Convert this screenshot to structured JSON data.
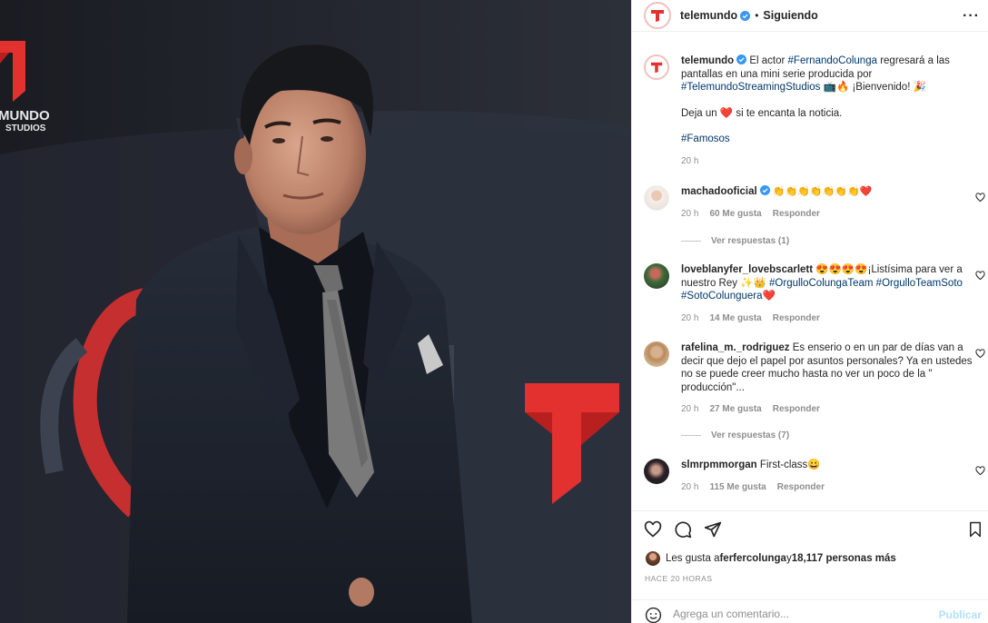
{
  "colors": {
    "link": "#00376b",
    "verified": "#3897f0",
    "heart": "#ed4956",
    "muted": "#8e8e8e",
    "brand_red": "#e2312f",
    "publish_disabled": "#b2dffc"
  },
  "photo": {
    "logo_text": [
      "MUNDO",
      "STUDIOS"
    ]
  },
  "header": {
    "username": "telemundo",
    "dot": "•",
    "status": "Siguiendo",
    "more_icon": "more-horizontal-icon"
  },
  "caption": {
    "username": "telemundo",
    "part1": " El actor ",
    "tag1": "#FernandoColunga",
    "part2": " regresará a las pantallas en una mini serie producida por ",
    "tag2": "#TelemundoStreamingStudios",
    "part3": " 📺🔥 ¡Bienvenido! 🎉",
    "line2": "Deja un ❤️ si te encanta la noticia.",
    "tag3": "#Famosos",
    "time": "20 h"
  },
  "comments": [
    {
      "username": "machadooficial",
      "verified": true,
      "text": " 👏👏👏👏👏👏👏❤️",
      "time": "20 h",
      "likes": "60 Me gusta",
      "reply": "Responder",
      "view_replies": "Ver respuestas (1)"
    },
    {
      "username": "loveblanyfer_lovebscarlett",
      "text_a": " 😍😍😍😍¡Listísima para ver a nuestro Rey ✨👑 ",
      "tag_a": "#OrgulloColungaTeam",
      "tag_b": "#OrgulloTeamSoto",
      "tag_c": "#SotoColunguera",
      "text_end": "❤️",
      "time": "20 h",
      "likes": "14 Me gusta",
      "reply": "Responder"
    },
    {
      "username": "rafelina_m._rodriguez",
      "text": " Es enserio o en un par de días van a decir que dejo el papel por asuntos personales? Ya en ustedes no se puede creer mucho hasta no ver un poco de la \" producción\"...",
      "time": "20 h",
      "likes": "27 Me gusta",
      "reply": "Responder",
      "view_replies": "Ver respuestas (7)"
    },
    {
      "username": "slmrpmmorgan",
      "text": " First-class😀",
      "time": "20 h",
      "likes": "115 Me gusta",
      "reply": "Responder"
    }
  ],
  "actions": {
    "icons": [
      "heart-icon",
      "comment-icon",
      "share-icon",
      "bookmark-icon"
    ],
    "likes_prefix": "Les gusta a ",
    "likes_user": "ferfercolunga",
    "likes_mid": " y ",
    "likes_count": "18,117 personas más",
    "ago": "HACE 20 HORAS",
    "comment_placeholder": "Agrega un comentario...",
    "publish": "Publicar"
  }
}
